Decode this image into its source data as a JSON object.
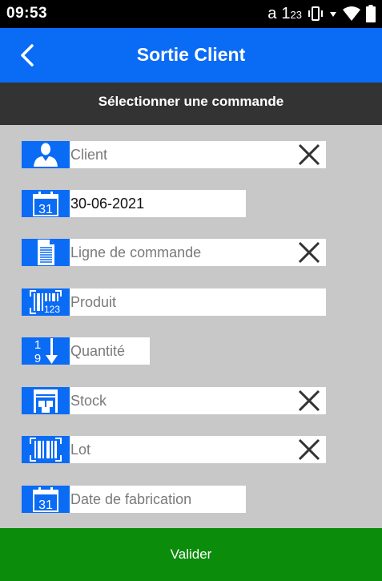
{
  "status_bar": {
    "time": "09:53",
    "indicators": [
      "a",
      "1",
      "23"
    ],
    "icons": [
      "input-a-icon",
      "numeric-input-icon",
      "vibrate-icon",
      "signal-dropdown-icon",
      "wifi-icon",
      "battery-icon"
    ]
  },
  "header": {
    "title": "Sortie Client"
  },
  "subheader": {
    "text": "Sélectionner une commande"
  },
  "fields": {
    "client": {
      "value": "",
      "placeholder": "Client",
      "icon": "user-icon"
    },
    "date": {
      "value": "30-06-2021",
      "placeholder": "",
      "icon": "calendar-icon",
      "icon_text": "31"
    },
    "order_line": {
      "value": "",
      "placeholder": "Ligne de commande",
      "icon": "document-icon"
    },
    "product": {
      "value": "",
      "placeholder": "Produit",
      "icon": "barcode-icon",
      "icon_text": "123"
    },
    "quantity": {
      "value": "",
      "placeholder": "Quantité",
      "icon": "sort-numeric-icon",
      "icon_text_top": "1",
      "icon_text_bottom": "9"
    },
    "stock": {
      "value": "",
      "placeholder": "Stock",
      "icon": "warehouse-icon"
    },
    "lot": {
      "value": "",
      "placeholder": "Lot",
      "icon": "barcode-icon"
    },
    "manufacture_date": {
      "value": "",
      "placeholder": "Date de fabrication",
      "icon": "calendar-icon",
      "icon_text": "31"
    }
  },
  "footer": {
    "validate_label": "Valider"
  },
  "colors": {
    "primary": "#0a6bf5",
    "subheader": "#333333",
    "background": "#c8c8c8",
    "validate": "#0b8c0b"
  }
}
